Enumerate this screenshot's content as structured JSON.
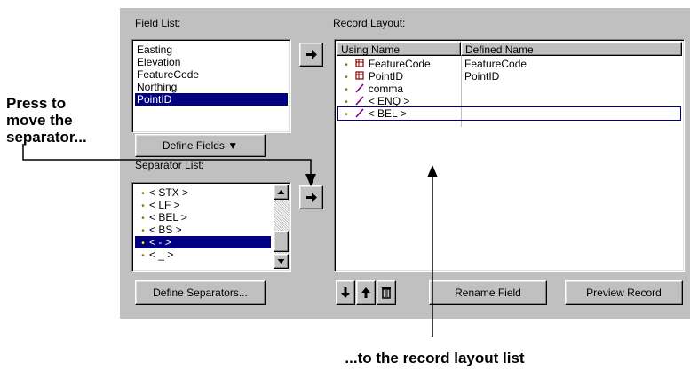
{
  "field_list": {
    "label": "Field List:",
    "items": [
      "Easting",
      "Elevation",
      "FeatureCode",
      "Northing",
      "PointID"
    ],
    "selected": "PointID"
  },
  "define_fields_button": "Define Fields ▼",
  "separator_list": {
    "label": "Separator List:",
    "items": [
      "< STX >",
      "< LF >",
      "< BEL >",
      "< BS >",
      "< - >",
      "< _ >"
    ],
    "selected": "< - >"
  },
  "define_separators_button": "Define Separators...",
  "record_layout": {
    "label": "Record Layout:",
    "columns": [
      "Using Name",
      "Defined Name"
    ],
    "rows": [
      {
        "using": "FeatureCode",
        "defined": "FeatureCode",
        "icon": "field-icon"
      },
      {
        "using": "PointID",
        "defined": "PointID",
        "icon": "field-icon"
      },
      {
        "using": "comma",
        "defined": "",
        "icon": "separator-icon"
      },
      {
        "using": "< ENQ >",
        "defined": "",
        "icon": "separator-icon"
      },
      {
        "using": "< BEL >",
        "defined": "",
        "icon": "separator-icon"
      }
    ]
  },
  "rename_field_button": "Rename Field",
  "preview_record_button": "Preview Record",
  "callouts": {
    "left_line1": "Press to",
    "left_line2": "move the",
    "left_line3": "separator...",
    "bottom": "...to the record layout list"
  },
  "colors": {
    "dialog_bg": "#c0c0c0",
    "selection": "#000080",
    "field_icon": "#800000",
    "separator_icon": "#800080"
  }
}
